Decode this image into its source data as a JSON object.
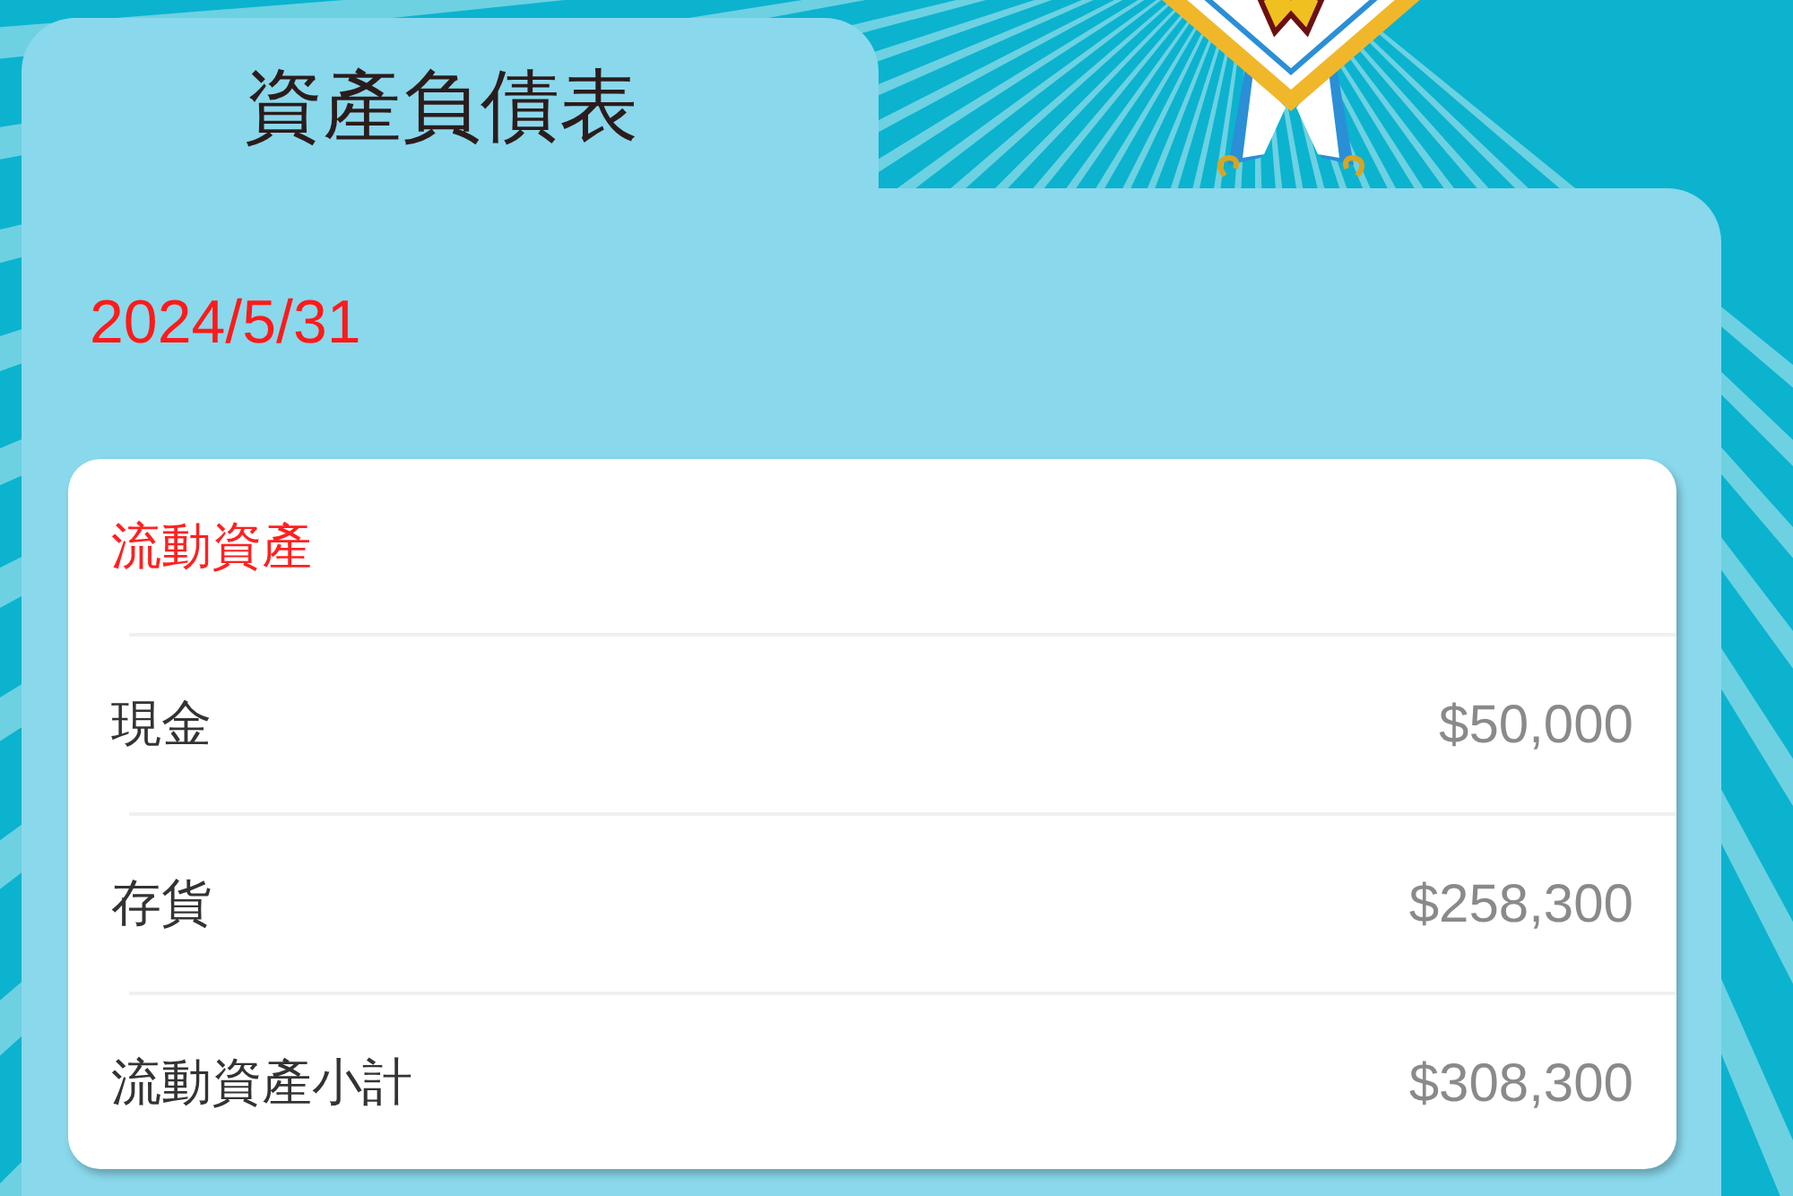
{
  "title": "資產負債表",
  "date": "2024/5/31",
  "section": {
    "heading": "流動資產",
    "rows": [
      {
        "label": "現金",
        "amount": "$50,000"
      },
      {
        "label": "存貨",
        "amount": "$258,300"
      },
      {
        "label": "流動資產小計",
        "amount": "$308,300"
      }
    ]
  }
}
